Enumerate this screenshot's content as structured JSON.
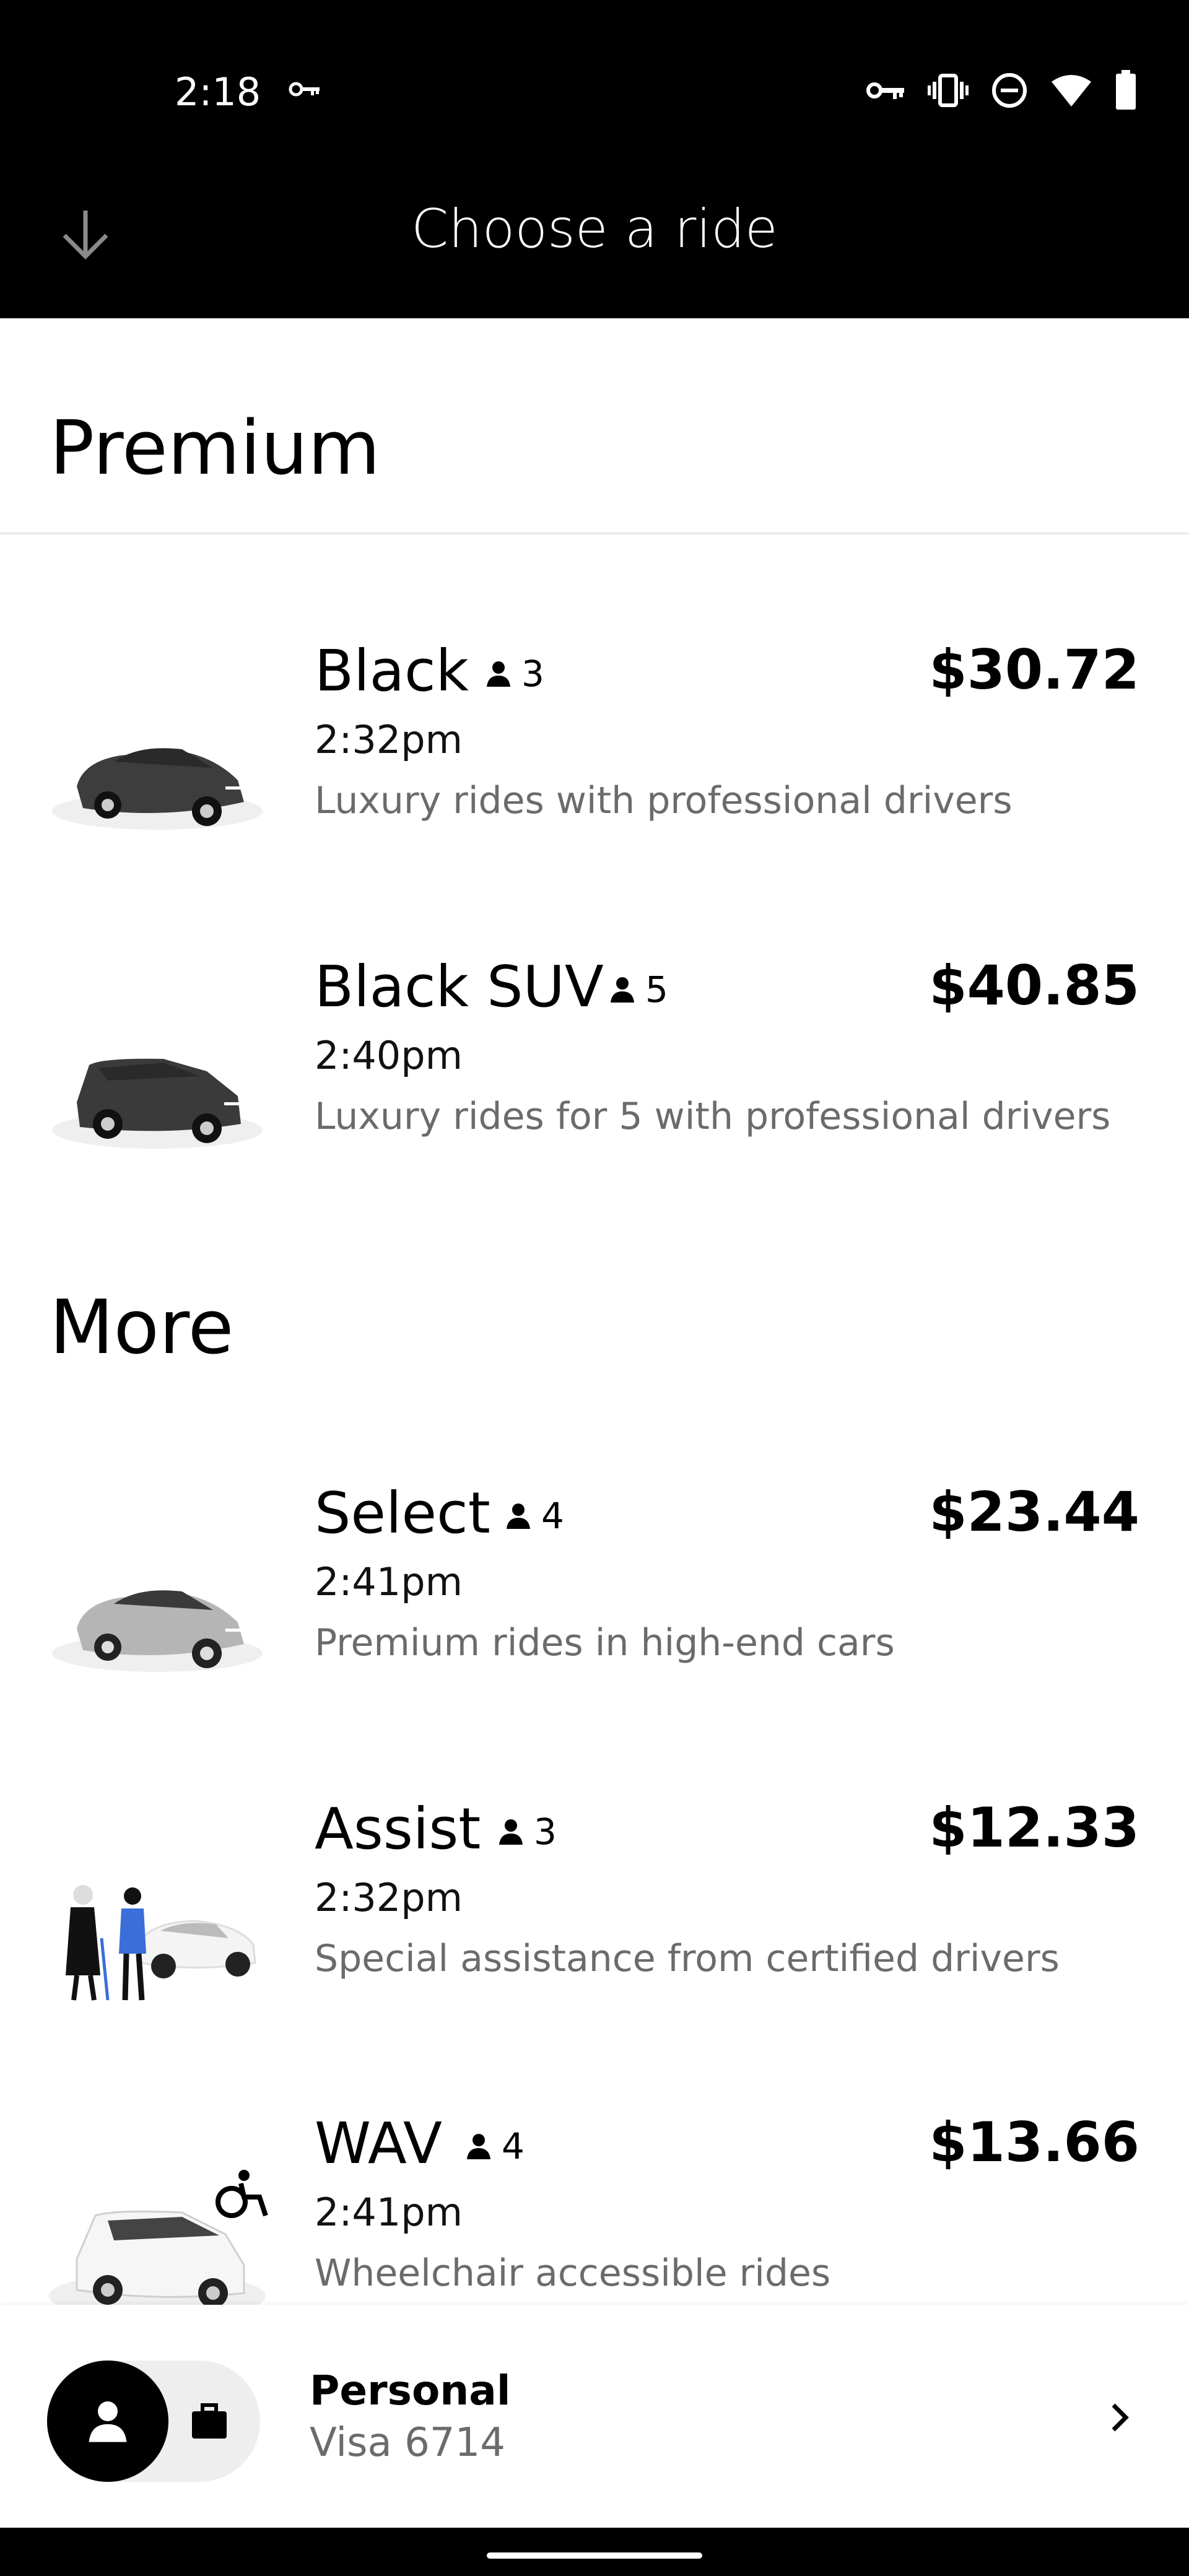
{
  "status_bar": {
    "time": "2:18",
    "icons": [
      "vpn-key-icon",
      "vibrate-icon",
      "do-not-disturb-icon",
      "wifi-icon",
      "battery-icon"
    ]
  },
  "header": {
    "title": "Choose a ride",
    "back_icon": "arrow-down-icon"
  },
  "sections": {
    "premium": {
      "title": "Premium"
    },
    "more": {
      "title": "More"
    }
  },
  "rides": {
    "black": {
      "name": "Black",
      "capacity": "3",
      "price": "$30.72",
      "time": "2:32pm",
      "description": "Luxury rides with professional drivers"
    },
    "black_suv": {
      "name": "Black SUV",
      "capacity": "5",
      "price": "$40.85",
      "time": "2:40pm",
      "description": "Luxury rides for 5 with professional drivers"
    },
    "select": {
      "name": "Select",
      "capacity": "4",
      "price": "$23.44",
      "time": "2:41pm",
      "description": "Premium rides in high-end cars"
    },
    "assist": {
      "name": "Assist",
      "capacity": "3",
      "price": "$12.33",
      "time": "2:32pm",
      "description": "Special assistance from certified drivers"
    },
    "wav": {
      "name": "WAV",
      "capacity": "4",
      "price": "$13.66",
      "time": "2:41pm",
      "description": "Wheelchair accessible rides"
    }
  },
  "payment": {
    "profile": "Personal",
    "method": "Visa 6714"
  },
  "colors": {
    "header_bg": "#000000",
    "secondary_text": "#6b6b6b"
  }
}
